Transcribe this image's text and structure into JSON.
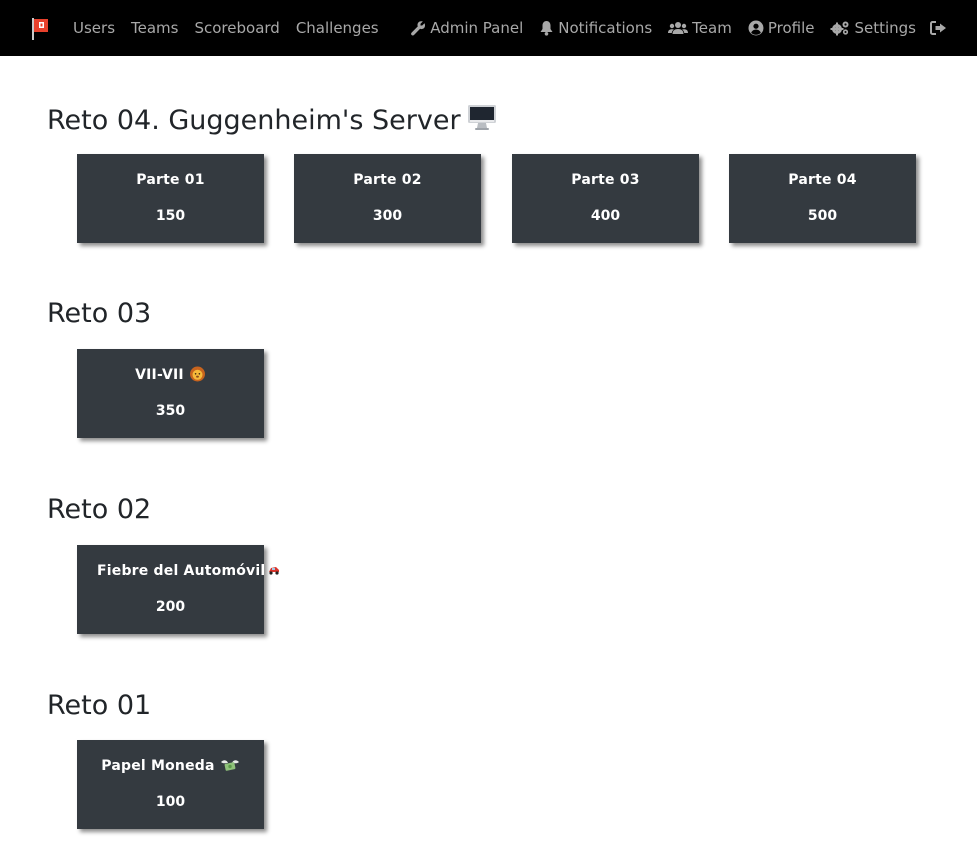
{
  "navbar": {
    "brand_icon": "flag-icon",
    "left_links": [
      "Users",
      "Teams",
      "Scoreboard",
      "Challenges"
    ],
    "admin_panel": "Admin Panel",
    "notifications": "Notifications",
    "team": "Team",
    "profile": "Profile",
    "settings": "Settings",
    "logout_icon": "sign-out-icon"
  },
  "categories": [
    {
      "title": "Reto 04. Guggenheim's Server",
      "emoji": "desktop-computer-emoji",
      "challenges": [
        {
          "name": "Parte 01",
          "value": "150"
        },
        {
          "name": "Parte 02",
          "value": "300"
        },
        {
          "name": "Parte 03",
          "value": "400"
        },
        {
          "name": "Parte 04",
          "value": "500"
        }
      ]
    },
    {
      "title": "Reto 03",
      "challenges": [
        {
          "name": "VII-VII",
          "emoji": "lion-face-emoji",
          "value": "350"
        }
      ]
    },
    {
      "title": "Reto 02",
      "challenges": [
        {
          "name": "Fiebre del Automóvil",
          "emoji": "race-car-emoji",
          "value": "200"
        }
      ]
    },
    {
      "title": "Reto 01",
      "challenges": [
        {
          "name": "Papel Moneda",
          "emoji": "money-with-wings-emoji",
          "value": "100"
        }
      ]
    }
  ],
  "colors": {
    "navbar_bg": "#000000",
    "nav_text": "#a8a8a8",
    "card_bg": "#343a40",
    "card_text": "#ffffff",
    "flag_red": "#e8412c"
  }
}
